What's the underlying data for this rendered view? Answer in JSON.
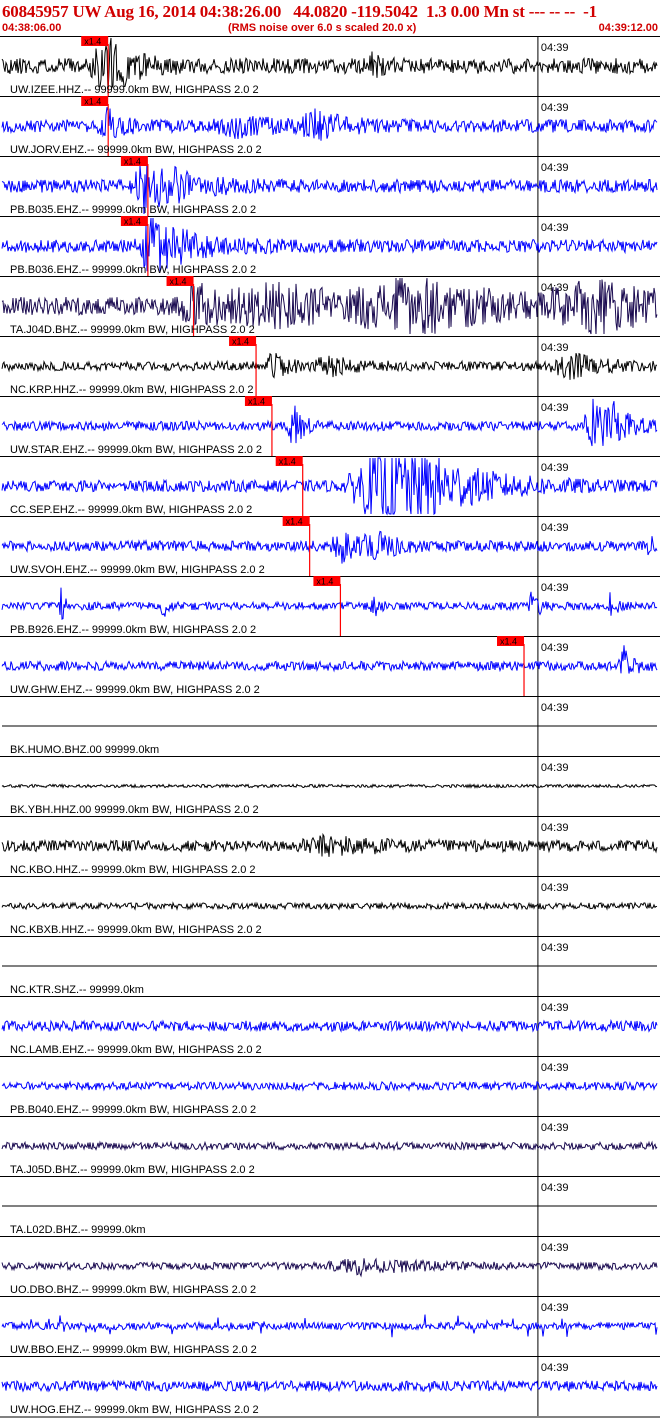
{
  "header": {
    "title": "60845957 UW Aug 16, 2014 04:38:26.00   44.0820 -119.5042  1.3 0.00 Mn st --- -- --  -1",
    "start_time": "04:38:06.00",
    "scaling_note": "(RMS noise over 6.0 s scaled 20.0 x)",
    "end_time": "04:39:12.00",
    "title_color": "#d10000"
  },
  "chart_data": {
    "type": "line",
    "time_range": [
      "04:38:06.00",
      "04:39:12.00"
    ],
    "minute_tick_label": "04:39",
    "minute_tick_time": "04:39:00",
    "pick_label": "x1.4",
    "colors": {
      "blue": "#0000ff",
      "black": "#000000",
      "purple": "#1a0a50",
      "pick": "#ff0000"
    },
    "traces": [
      {
        "label": "UW.IZEE.HHZ.-- 99999.0km BW, HIGHPASS  2.0  2",
        "color": "black",
        "amplitude": 0.3,
        "pick_time": "04:38:16.7",
        "events": [
          [
            0.155,
            0.9,
            0.015
          ],
          [
            0.16,
            0.7,
            0.03
          ],
          [
            0.565,
            0.4,
            0.008
          ]
        ],
        "seed": 11
      },
      {
        "label": "UW.JORV.EHZ.-- 99999.0km BW, HIGHPASS  2.0  2",
        "color": "blue",
        "amplitude": 0.25,
        "pick_time": "04:38:16.7",
        "events": [
          [
            0.16,
            0.55,
            0.015
          ],
          [
            0.36,
            0.3,
            0.04
          ],
          [
            0.48,
            0.45,
            0.03
          ]
        ],
        "seed": 12
      },
      {
        "label": "PB.B035.EHZ.-- 99999.0km BW, HIGHPASS  2.0  2",
        "color": "blue",
        "amplitude": 0.25,
        "pick_time": "04:38:20.7",
        "events": [
          [
            0.22,
            0.9,
            0.02
          ],
          [
            0.24,
            0.5,
            0.05
          ]
        ],
        "seed": 13
      },
      {
        "label": "PB.B036.EHZ.-- 99999.0km BW, HIGHPASS  2.0  2",
        "color": "blue",
        "amplitude": 0.25,
        "pick_time": "04:38:20.7",
        "events": [
          [
            0.225,
            0.95,
            0.02
          ],
          [
            0.25,
            0.5,
            0.05
          ]
        ],
        "seed": 14
      },
      {
        "label": "TA.J04D.BHZ.-- 99999.0km BW, HIGHPASS  2.0  2",
        "color": "purple",
        "amplitude": 0.35,
        "pick_time": "04:38:25.3",
        "events": [
          [
            0.3,
            0.6,
            0.04
          ],
          [
            0.42,
            0.6,
            0.1
          ],
          [
            0.62,
            0.9,
            0.1
          ],
          [
            0.9,
            0.8,
            0.08
          ]
        ],
        "seed": 15
      },
      {
        "label": "NC.KRP.HHZ.-- 99999.0km BW, HIGHPASS  2.0  2",
        "color": "black",
        "amplitude": 0.18,
        "pick_time": "04:38:31.6",
        "events": [
          [
            0.415,
            0.6,
            0.015
          ],
          [
            0.5,
            0.3,
            0.03
          ],
          [
            0.87,
            0.4,
            0.04
          ]
        ],
        "seed": 16
      },
      {
        "label": "UW.STAR.EHZ.-- 99999.0km BW, HIGHPASS  2.0  2",
        "color": "blue",
        "amplitude": 0.18,
        "pick_time": "04:38:33.2",
        "events": [
          [
            0.445,
            0.8,
            0.01
          ],
          [
            0.9,
            1.0,
            0.015
          ],
          [
            0.93,
            0.8,
            0.02
          ]
        ],
        "seed": 17
      },
      {
        "label": "CC.SEP.EHZ.-- 99999.0km BW, HIGHPASS  2.0  2",
        "color": "blue",
        "amplitude": 0.22,
        "pick_time": "04:38:36.3",
        "events": [
          [
            0.58,
            1.6,
            0.06
          ],
          [
            0.64,
            0.7,
            0.07
          ]
        ],
        "seed": 18
      },
      {
        "label": "UW.SVOH.EHZ.-- 99999.0km BW, HIGHPASS  2.0  2",
        "color": "blue",
        "amplitude": 0.2,
        "pick_time": "04:38:37.0",
        "events": [
          [
            0.52,
            0.6,
            0.02
          ],
          [
            0.57,
            0.5,
            0.02
          ],
          [
            0.985,
            1.0,
            0.005
          ]
        ],
        "seed": 19
      },
      {
        "label": "PB.B926.EHZ.-- 99999.0km BW, HIGHPASS  2.0  2",
        "color": "blue",
        "amplitude": 0.15,
        "pick_time": "04:38:40.1",
        "events": [
          [
            0.09,
            0.7,
            0.004
          ],
          [
            0.245,
            0.5,
            0.005
          ],
          [
            0.565,
            0.9,
            0.005
          ],
          [
            0.81,
            0.8,
            0.006
          ],
          [
            0.93,
            0.6,
            0.005
          ]
        ],
        "seed": 20
      },
      {
        "label": "UW.GHW.EHZ.-- 99999.0km BW, HIGHPASS  2.0  2",
        "color": "blue",
        "amplitude": 0.18,
        "pick_time": "04:38:58.6",
        "events": [
          [
            0.95,
            0.7,
            0.01
          ]
        ],
        "seed": 21
      },
      {
        "label": "BK.HUMO.BHZ.00 99999.0km",
        "color": "black",
        "amplitude": 0.0,
        "events": [],
        "seed": 22
      },
      {
        "label": "BK.YBH.HHZ.00 99999.0km BW, HIGHPASS  2.0  2",
        "color": "black",
        "amplitude": 0.06,
        "events": [],
        "seed": 23
      },
      {
        "label": "NC.KBO.HHZ.-- 99999.0km BW, HIGHPASS  2.0  2",
        "color": "black",
        "amplitude": 0.22,
        "events": [
          [
            0.5,
            0.3,
            0.05
          ]
        ],
        "seed": 24
      },
      {
        "label": "NC.KBXB.HHZ.-- 99999.0km BW, HIGHPASS  2.0  2",
        "color": "black",
        "amplitude": 0.12,
        "events": [],
        "seed": 25
      },
      {
        "label": "NC.KTR.SHZ.-- 99999.0km",
        "color": "black",
        "amplitude": 0.0,
        "events": [],
        "seed": 26
      },
      {
        "label": "NC.LAMB.EHZ.-- 99999.0km BW, HIGHPASS  2.0  2",
        "color": "blue",
        "amplitude": 0.2,
        "events": [],
        "seed": 27
      },
      {
        "label": "PB.B040.EHZ.-- 99999.0km BW, HIGHPASS  2.0  2",
        "color": "blue",
        "amplitude": 0.16,
        "events": [],
        "seed": 28
      },
      {
        "label": "TA.J05D.BHZ.-- 99999.0km BW, HIGHPASS  2.0  2",
        "color": "purple",
        "amplitude": 0.14,
        "events": [],
        "seed": 29
      },
      {
        "label": "TA.L02D.BHZ.-- 99999.0km",
        "color": "black",
        "amplitude": 0.0,
        "events": [],
        "seed": 30
      },
      {
        "label": "UO.DBO.BHZ.-- 99999.0km BW, HIGHPASS  2.0  2",
        "color": "purple",
        "amplitude": 0.14,
        "events": [
          [
            0.55,
            0.25,
            0.06
          ]
        ],
        "seed": 31
      },
      {
        "label": "UW.BBO.EHZ.-- 99999.0km BW, HIGHPASS  2.0  2",
        "color": "blue",
        "amplitude": 0.14,
        "spiky": true,
        "events": [],
        "seed": 32
      },
      {
        "label": "UW.HOG.EHZ.-- 99999.0km BW, HIGHPASS  2.0  2",
        "color": "blue",
        "amplitude": 0.2,
        "events": [],
        "seed": 33
      }
    ]
  }
}
